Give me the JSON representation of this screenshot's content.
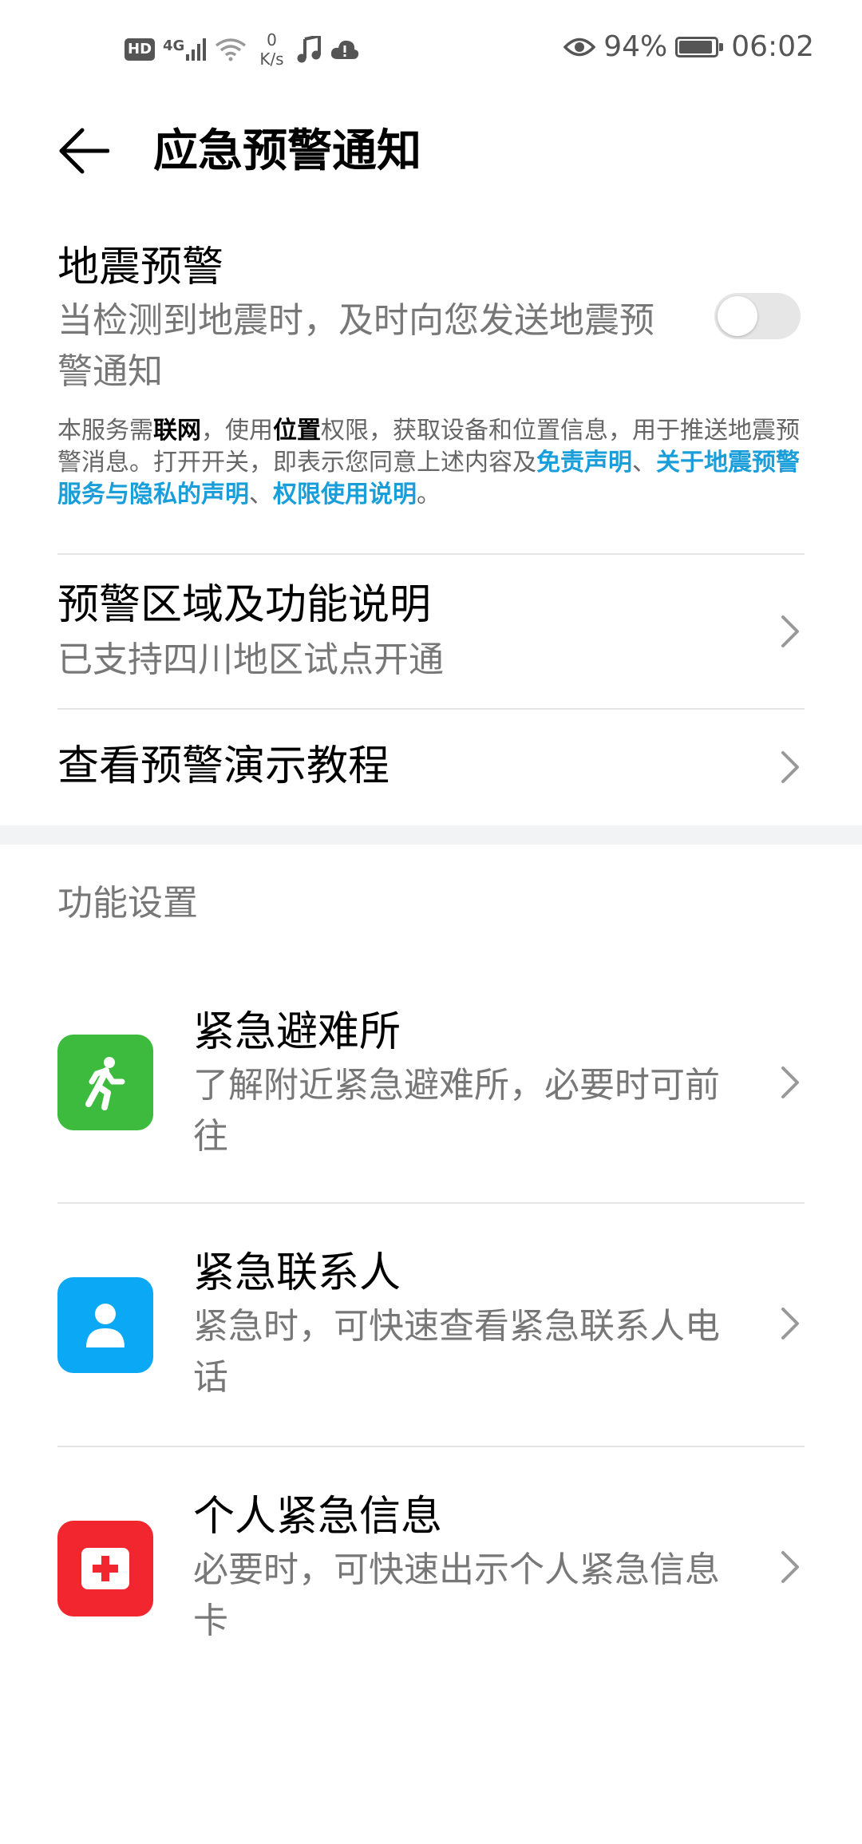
{
  "status_bar": {
    "hd": "HD",
    "network": "4G",
    "speed_value": "0",
    "speed_unit": "K/s",
    "battery": "94%",
    "battery_level": 0.94,
    "time": "06:02",
    "icons": [
      "hd-icon",
      "signal-icon",
      "wifi-icon",
      "music-icon",
      "cloud-icon",
      "eye-icon",
      "battery-icon"
    ]
  },
  "header": {
    "title": "应急预警通知"
  },
  "earthquake": {
    "title": "地震预警",
    "desc": "当检测到地震时，及时向您发送地震预警通知",
    "toggle_on": false,
    "notice": {
      "p1": "本服务需",
      "b1": "联网",
      "p2": "，使用",
      "b2": "位置",
      "p3": "权限，获取设备和位置信息，用于推送地震预警消息。打开开关，即表示您同意上述内容及",
      "link1": "免责声明",
      "sep1": "、",
      "link2": "关于地震预警服务与隐私的声明",
      "sep2": "、",
      "link3": "权限使用说明",
      "end": "。"
    }
  },
  "region": {
    "title": "预警区域及功能说明",
    "desc": "已支持四川地区试点开通"
  },
  "tutorial": {
    "title": "查看预警演示教程"
  },
  "settings": {
    "header": "功能设置",
    "items": [
      {
        "title": "紧急避难所",
        "desc": "了解附近紧急避难所，必要时可前往",
        "icon": "running-person-icon",
        "color": "#3dbb3f"
      },
      {
        "title": "紧急联系人",
        "desc": "紧急时，可快速查看紧急联系人电话",
        "icon": "contact-person-icon",
        "color": "#0aa8f5"
      },
      {
        "title": "个人紧急信息",
        "desc": "必要时，可快速出示个人紧急信息卡",
        "icon": "medical-cross-icon",
        "color": "#f2262f"
      }
    ]
  },
  "colors": {
    "link": "#1a9ed9",
    "secondary_text": "#777777",
    "divider": "#e5e5e5"
  }
}
